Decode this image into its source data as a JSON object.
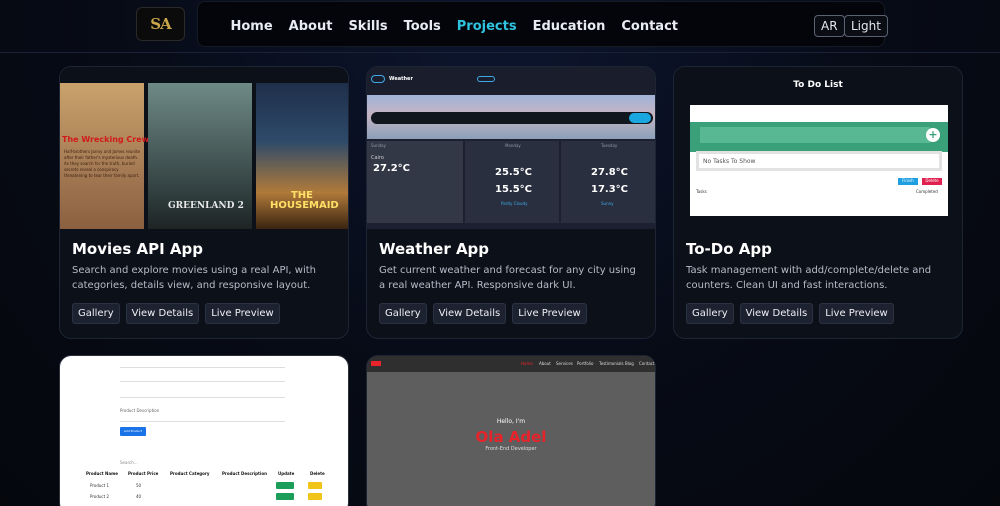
{
  "brand": {
    "logo_text": "SA"
  },
  "nav": {
    "links": [
      "Home",
      "About",
      "Skills",
      "Tools",
      "Projects",
      "Education",
      "Contact"
    ],
    "active": "Projects",
    "lang_button": "AR",
    "theme_button": "Light"
  },
  "projects": [
    {
      "title": "Movies API App",
      "description": "Search and explore movies using a real API, with categories, details view, and responsive layout.",
      "buttons": [
        "Gallery",
        "View Details",
        "Live Preview"
      ],
      "thumb": {
        "poster1_title": "The Wrecking Crew",
        "poster1_text": "Half-brothers Jonny and James reunite after their father's mysterious death. As they search for the truth, buried secrets reveal a conspiracy threatening to tear their family apart.",
        "poster2_title": "GREENLAND 2",
        "poster3_title_1": "THE",
        "poster3_title_2": "HOUSEMAID"
      }
    },
    {
      "title": "Weather App",
      "description": "Get current weather and forecast for any city using a real weather API. Responsive dark UI.",
      "buttons": [
        "Gallery",
        "View Details",
        "Live Preview"
      ],
      "thumb": {
        "app_name": "Weather",
        "city": "Cairo",
        "today_temp": "27.2°C",
        "day2_high": "25.5°C",
        "day2_low": "15.5°C",
        "day3_high": "27.8°C",
        "day3_low": "17.3°C",
        "day1_label": "Sunday",
        "day2_label": "Monday",
        "day3_label": "Tuesday",
        "day2_condition": "Partly Cloudy",
        "day3_condition": "Sunny"
      }
    },
    {
      "title": "To-Do App",
      "description": "Task management with add/complete/delete and counters. Clean UI and fast interactions.",
      "buttons": [
        "Gallery",
        "View Details",
        "Live Preview"
      ],
      "thumb": {
        "heading": "To Do List",
        "empty_text": "No Tasks To Show",
        "btn_finish": "Finish",
        "btn_delete": "Delete",
        "tasks_label": "Tasks",
        "completed_label": "Completed"
      }
    },
    {
      "thumb": {
        "fields": [
          "",
          "",
          "",
          "Product Description"
        ],
        "button": "Add Product",
        "search_label": "Search...",
        "headers": [
          "Product Name",
          "Product Price",
          "Product Category",
          "Product Description",
          "Update",
          "Delete"
        ],
        "rows": [
          [
            "Product 1",
            "50"
          ],
          [
            "Product 2",
            "40"
          ]
        ]
      }
    },
    {
      "thumb": {
        "nav_links": [
          "Home",
          "About",
          "Services",
          "Portfolio",
          "Testimonials",
          "Blog",
          "Contact"
        ],
        "hello": "Hello, I'm",
        "name": "Ola Adel",
        "role": "Front-End Developer"
      }
    }
  ]
}
